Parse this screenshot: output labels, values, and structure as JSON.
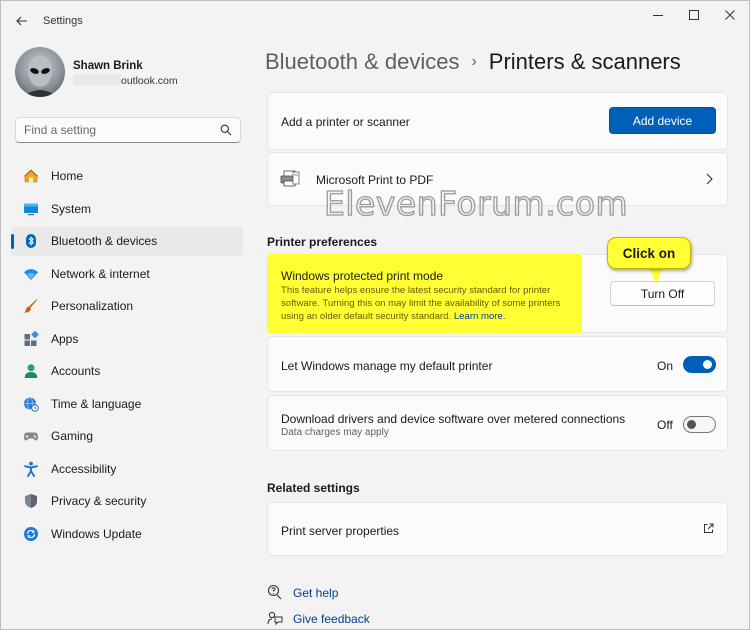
{
  "window": {
    "title": "Settings"
  },
  "profile": {
    "name": "Shawn Brink",
    "email_suffix": "outlook.com"
  },
  "search": {
    "placeholder": "Find a setting"
  },
  "nav": {
    "items": [
      {
        "label": "Home",
        "icon": "home-icon",
        "active": false
      },
      {
        "label": "System",
        "icon": "monitor-icon",
        "active": false
      },
      {
        "label": "Bluetooth & devices",
        "icon": "bluetooth-icon",
        "active": true
      },
      {
        "label": "Network & internet",
        "icon": "wifi-icon",
        "active": false
      },
      {
        "label": "Personalization",
        "icon": "brush-icon",
        "active": false
      },
      {
        "label": "Apps",
        "icon": "apps-icon",
        "active": false
      },
      {
        "label": "Accounts",
        "icon": "person-icon",
        "active": false
      },
      {
        "label": "Time & language",
        "icon": "globe-clock-icon",
        "active": false
      },
      {
        "label": "Gaming",
        "icon": "gamepad-icon",
        "active": false
      },
      {
        "label": "Accessibility",
        "icon": "accessibility-icon",
        "active": false
      },
      {
        "label": "Privacy & security",
        "icon": "shield-icon",
        "active": false
      },
      {
        "label": "Windows Update",
        "icon": "update-icon",
        "active": false
      }
    ]
  },
  "header": {
    "parent": "Bluetooth & devices",
    "separator": "›",
    "current": "Printers & scanners"
  },
  "add_printer": {
    "label": "Add a printer or scanner",
    "button": "Add device"
  },
  "printer": {
    "name": "Microsoft Print to PDF"
  },
  "watermark": "ElevenForum.com",
  "preferences": {
    "title": "Printer preferences",
    "protected_mode": {
      "title": "Windows protected print mode",
      "description": "This feature helps ensure the latest security standard for printer software. Turning this on may limit the availability of some printers using an older default security standard.",
      "link": "Learn more.",
      "button": "Turn Off"
    },
    "default_printer": {
      "label": "Let Windows manage my default printer",
      "state": "On"
    },
    "metered": {
      "label": "Download drivers and device software over metered connections",
      "sub": "Data charges may apply",
      "state": "Off"
    }
  },
  "callout": {
    "text": "Click on"
  },
  "related": {
    "title": "Related settings",
    "print_server": "Print server properties"
  },
  "help": {
    "get_help": "Get help",
    "give_feedback": "Give feedback"
  },
  "colors": {
    "accent": "#005fb8",
    "highlight": "#ffff33"
  }
}
